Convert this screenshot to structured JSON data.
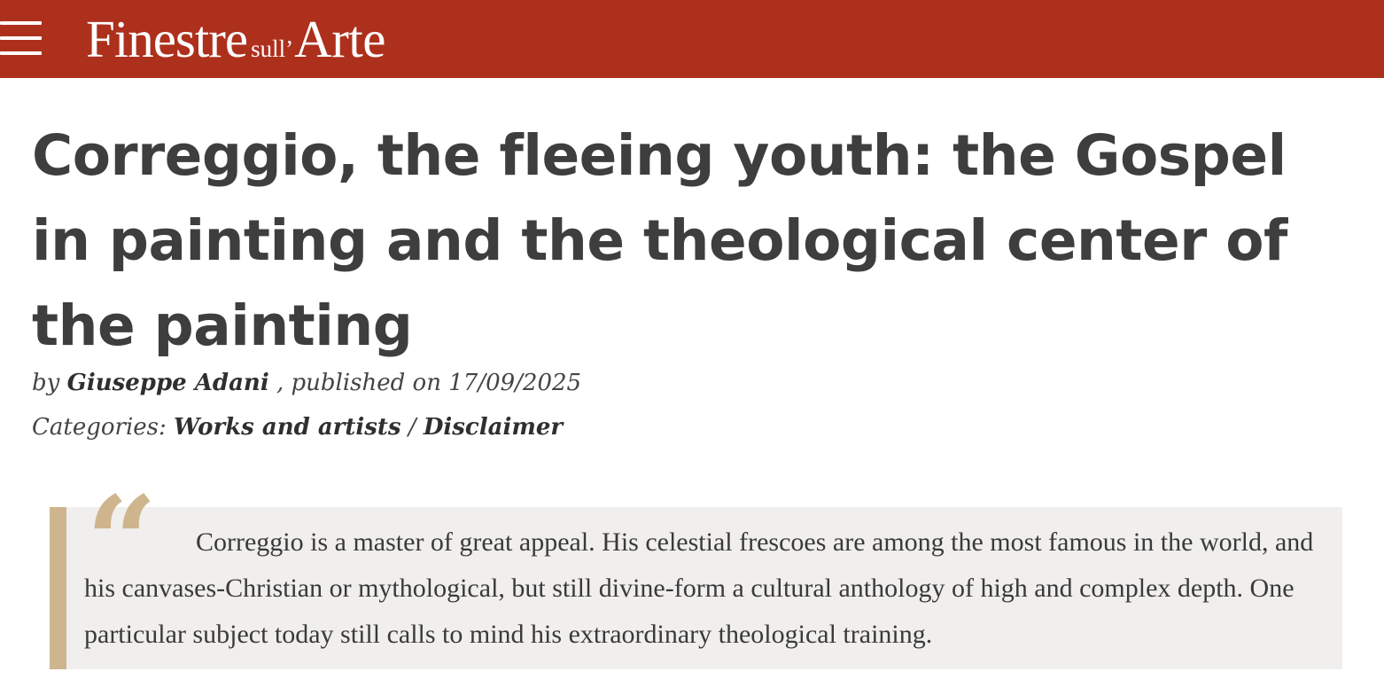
{
  "header": {
    "menu_icon": "hamburger-menu-icon",
    "logo": {
      "main": "Finestre",
      "small": "sull’",
      "arte": "Arte"
    },
    "background_color": "#ad301c"
  },
  "article": {
    "title": "Correggio, the fleeing youth: the Gospel in painting and the theological center of the painting",
    "byline": {
      "by_prefix": "by",
      "author": "Giuseppe Adani",
      "published_prefix": ", published on",
      "date": "17/09/2025"
    },
    "categories": {
      "label": "Categories:",
      "items": [
        "Works and artists",
        "Disclaimer"
      ],
      "separator": "/"
    },
    "quote": {
      "mark": "“",
      "text": "Correggio is a master of great appeal. His celestial frescoes are among the most famous in the world, and his canvases-Christian or mythological, but still divine-form a cultural anthology of high and complex depth. One particular subject today still calls to mind his extraordinary theological training.",
      "accent_color": "#cfb58e"
    }
  }
}
